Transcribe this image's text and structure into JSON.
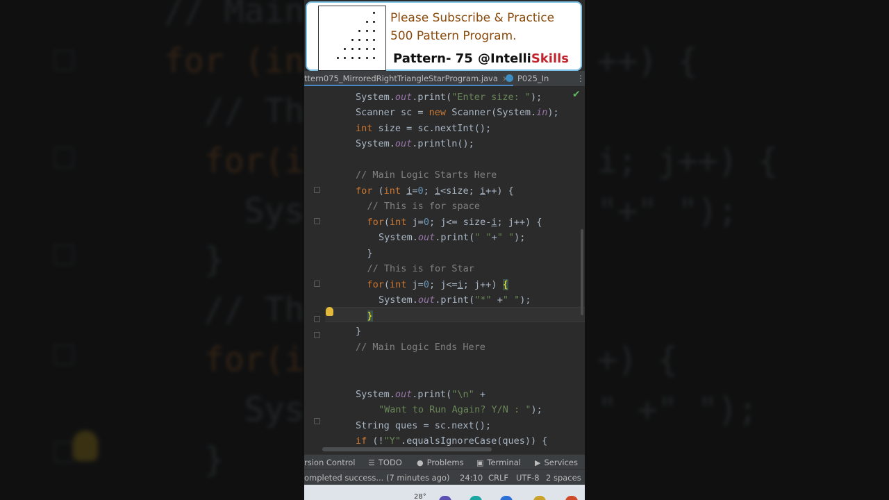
{
  "background_code": {
    "lines": [
      {
        "pre": "// Main",
        "kind": "comment"
      },
      {
        "pre": "for (int",
        "post": "++) {",
        "kind": "for"
      },
      {
        "pre": "  // Thi",
        "kind": "comment"
      },
      {
        "pre": "  for(in",
        "post": "i; j++) {",
        "kind": "for"
      },
      {
        "pre": "    Syst",
        "post": "\"+\" \");",
        "kind": "code"
      },
      {
        "pre": "  }",
        "kind": "code"
      },
      {
        "pre": "  // Thi",
        "kind": "comment"
      },
      {
        "pre": "  for(in",
        "post": "+) {",
        "kind": "for"
      },
      {
        "pre": "    Syst",
        "post": "\" +\" \");",
        "kind": "code"
      },
      {
        "pre": "  }",
        "kind": "code"
      }
    ]
  },
  "banner": {
    "line1": "Please Subscribe & Practice",
    "line2": "500 Pattern Program.",
    "pattern_label": "Pattern- 75",
    "handle_prefix": "@Intelli",
    "handle_suffix": "Skills",
    "thumb_rows": 6
  },
  "tabs": {
    "active": "ttern075_MirroredRightTriangleStarProgram.java",
    "active_close": "×",
    "second": "P025_In",
    "menu": "⋮"
  },
  "editor": {
    "lines": [
      {
        "indent": 2,
        "html": "System.<i>out</i>.print(<s>\"Enter size: \"</s>);"
      },
      {
        "indent": 2,
        "html": "Scanner sc = <k>new</k> Scanner(System.<i>in</i>);"
      },
      {
        "indent": 2,
        "html": "<k>int</k> size = sc.nextInt();"
      },
      {
        "indent": 2,
        "html": "System.<i>out</i>.println();"
      },
      {
        "indent": 2,
        "html": ""
      },
      {
        "indent": 2,
        "html": "<c>// Main Logic Starts Here</c>"
      },
      {
        "indent": 2,
        "html": "<k>for</k> (<k>int</k> <u>i</u>=<n>0</n>; <u>i</u>&lt;size; <u>i</u>++) {"
      },
      {
        "indent": 3,
        "html": "<c>// This is for space</c>"
      },
      {
        "indent": 3,
        "html": "<k>for</k>(<k>int</k> j=<n>0</n>; j&lt;= size-<u>i</u>; j++) {"
      },
      {
        "indent": 4,
        "html": "System.<i>out</i>.print(<s>\" \"</s>+<s>\" \"</s>);"
      },
      {
        "indent": 3,
        "html": "}"
      },
      {
        "indent": 3,
        "html": "<c>// This is for Star</c>"
      },
      {
        "indent": 3,
        "html": "<k>for</k>(<k>int</k> j=<n>0</n>; j&lt;=<u>i</u>; j++) <h>{</h>"
      },
      {
        "indent": 4,
        "html": "System.<i>out</i>.print(<s>\"*\"</s> +<s>\" \"</s>);"
      },
      {
        "indent": 3,
        "html": "<h>}</h>"
      },
      {
        "indent": 2,
        "html": "}"
      },
      {
        "indent": 2,
        "html": "<c>// Main Logic Ends Here</c>"
      },
      {
        "indent": 2,
        "html": ""
      },
      {
        "indent": 2,
        "html": ""
      },
      {
        "indent": 2,
        "html": "System.<i>out</i>.print(<s>\"\\n\"</s> +"
      },
      {
        "indent": 4,
        "html": "<s>\"Want to Run Again? Y/N : \"</s>);"
      },
      {
        "indent": 2,
        "html": "String ques = sc.next();"
      },
      {
        "indent": 2,
        "html": "<k>if</k> (!<s>\"Y\"</s>.equalsIgnoreCase(ques)) {"
      }
    ]
  },
  "tool_windows": [
    {
      "label": "rsion Control",
      "icon": ""
    },
    {
      "label": "TODO",
      "icon": "☰"
    },
    {
      "label": "Problems",
      "icon": "●"
    },
    {
      "label": "Terminal",
      "icon": "▣"
    },
    {
      "label": "Services",
      "icon": "▶"
    }
  ],
  "status": {
    "message": "ompleted success... (7 minutes ago)",
    "position": "24:10",
    "line_sep": "CRLF",
    "encoding": "UTF-8",
    "indent": "2 spaces"
  },
  "taskbar": {
    "temperature": "28°"
  },
  "colors": {
    "keyword": "#cc7832",
    "string": "#6a8759",
    "comment": "#808080",
    "number": "#6897bb",
    "field": "#9876aa",
    "banner_text": "#8a4a0c",
    "brand_red": "#c0242c"
  }
}
